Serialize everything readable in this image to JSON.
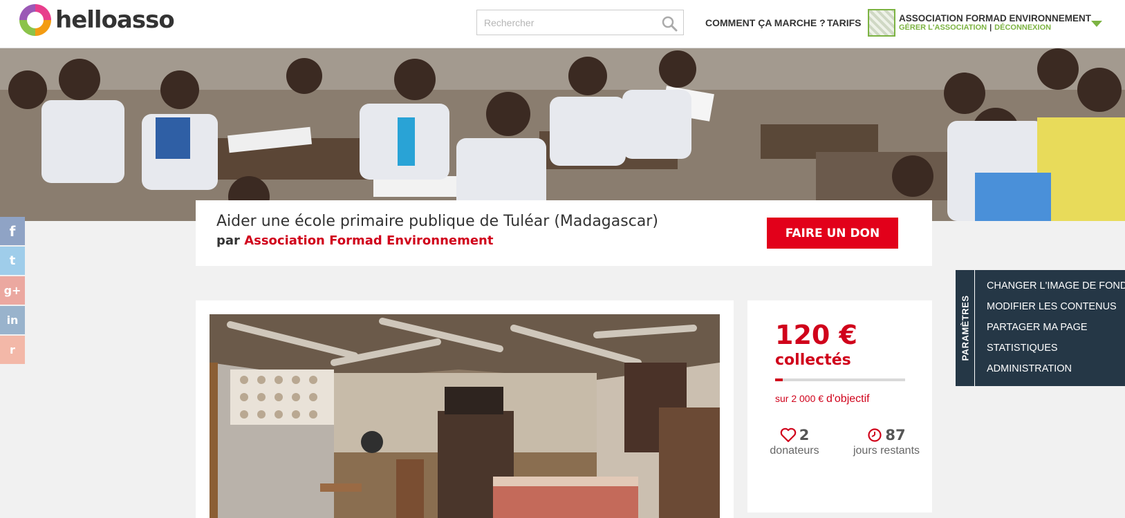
{
  "header": {
    "logo_text": "helloasso",
    "search_placeholder": "Rechercher",
    "nav_how": "COMMENT ÇA MARCHE ?",
    "nav_tarifs": "TARIFS",
    "org_name": "ASSOCIATION FORMAD ENVIRONNEMENT",
    "org_manage": "GÉRER L'ASSOCIATION",
    "org_separator": "|",
    "org_logout": "DÉCONNEXION"
  },
  "campaign": {
    "title": "Aider une école primaire publique de Tuléar (Madagascar)",
    "by_prefix": "par",
    "org_link": "Association Formad Environnement",
    "donate_button": "FAIRE UN DON"
  },
  "social": {
    "facebook": "f",
    "twitter": "t",
    "googleplus": "g+",
    "linkedin": "in",
    "reddit": "r"
  },
  "stats": {
    "amount": "120 €",
    "amount_label": "collectés",
    "progress_fraction": 0.06,
    "goal_prefix": "sur 2 000 €",
    "goal_suffix": "d'objectif",
    "donors_count": "2",
    "donors_label": "donateurs",
    "days_count": "87",
    "days_label": "jours restants"
  },
  "settings": {
    "tab_label": "PARAMÈTRES",
    "items": [
      "CHANGER L'IMAGE DE FOND",
      "MODIFIER LES CONTENUS",
      "PARTAGER MA PAGE",
      "STATISTIQUES",
      "ADMINISTRATION"
    ]
  },
  "icons": {
    "search": "search-icon",
    "heart": "heart-icon",
    "clock": "clock-icon",
    "caret": "chevron-down-icon"
  },
  "colors": {
    "brand_red": "#d0021b",
    "brand_green": "#7cb342",
    "settings_bg": "#253746"
  }
}
